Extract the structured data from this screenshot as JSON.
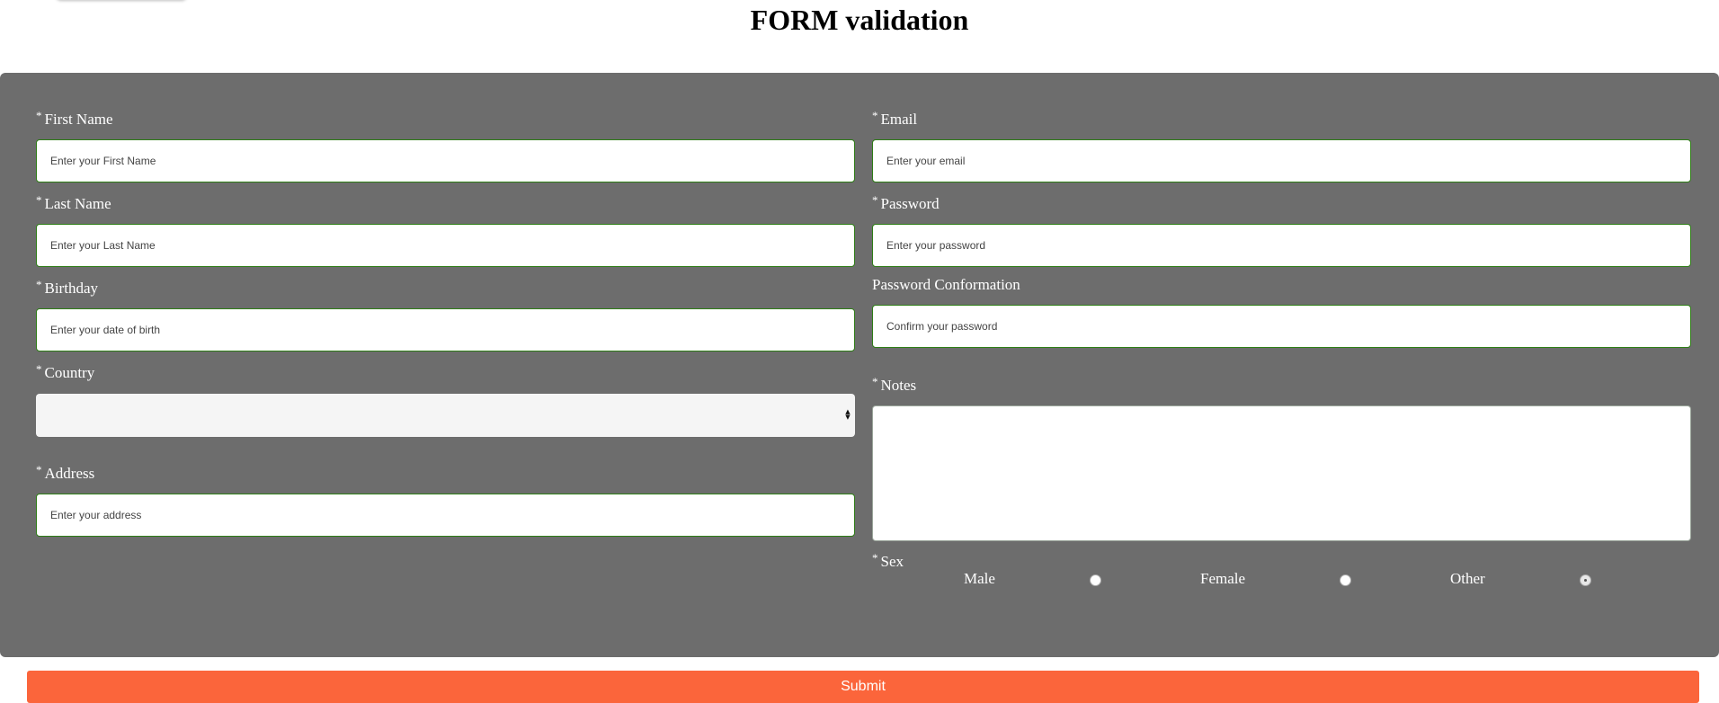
{
  "page": {
    "title": "FORM validation"
  },
  "form": {
    "required_mark": "*",
    "first_name": {
      "label": "First Name",
      "placeholder": "Enter your First Name"
    },
    "last_name": {
      "label": "Last Name",
      "placeholder": "Enter your Last Name"
    },
    "birthday": {
      "label": "Birthday",
      "placeholder": "Enter your date of birth"
    },
    "country": {
      "label": "Country",
      "value": ""
    },
    "address": {
      "label": "Address",
      "placeholder": "Enter your address"
    },
    "email": {
      "label": "Email",
      "placeholder": "Enter your email"
    },
    "password": {
      "label": "Password",
      "placeholder": "Enter your password"
    },
    "password_confirmation": {
      "label": "Password Conformation",
      "placeholder": "Confirm your password"
    },
    "notes": {
      "label": "Notes",
      "value": ""
    },
    "sex": {
      "label": "Sex",
      "options": [
        {
          "label": "Male",
          "checked": false
        },
        {
          "label": "Female",
          "checked": false
        },
        {
          "label": "Other",
          "checked": true
        }
      ]
    },
    "submit_label": "Submit"
  },
  "colors": {
    "panel": "#6d6d6d",
    "submit": "#fb653b",
    "input_border": "#2e7d16"
  },
  "icons": {
    "select": "chevron-up-down-icon"
  }
}
